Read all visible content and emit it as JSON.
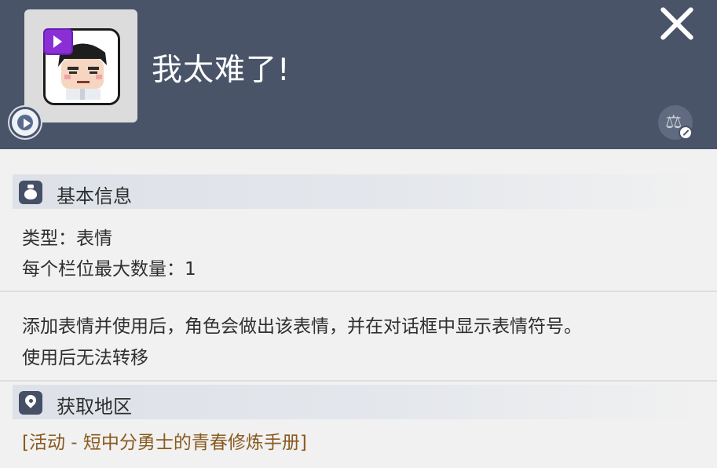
{
  "header": {
    "title": "我太难了!",
    "item_icon": "pixel-face-emote",
    "background": "#4a5469"
  },
  "basic_info": {
    "label": "基本信息",
    "type_line": "类型：表情",
    "max_line": "每个栏位最大数量：1"
  },
  "description": {
    "line1": "添加表情并使用后，角色会做出该表情，并在对话框中显示表情符号。",
    "line2": "使用后无法转移"
  },
  "acquisition": {
    "label": "获取地区",
    "source": "[活动 - 短中分勇士的青春修炼手册]"
  },
  "icons": {
    "close": "close-icon",
    "play": "play-icon",
    "scale": "scale-icon",
    "bag": "bag-icon",
    "pin": "location-pin-icon"
  }
}
